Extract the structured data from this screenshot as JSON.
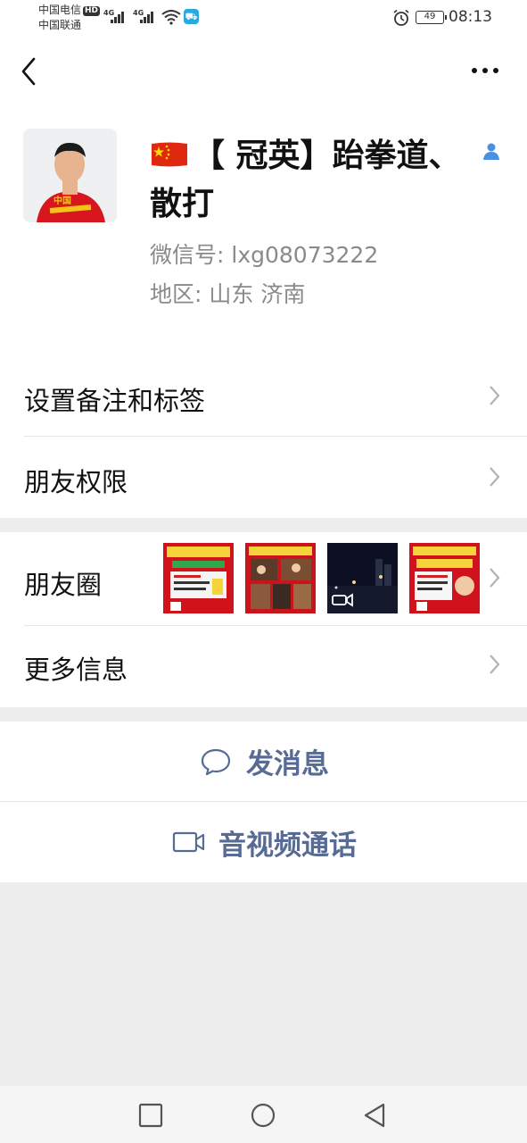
{
  "status": {
    "carrier1": "中国电信",
    "carrier1_badge": "HD",
    "carrier2": "中国联通",
    "net1": "4G",
    "net2": "4G",
    "battery": "49",
    "time": "08:13"
  },
  "header": {
    "back_icon": "chevron-left-icon",
    "more_icon": "more-dots-icon"
  },
  "profile": {
    "nickname": "【 冠英】跆拳道、散打",
    "wechat_id": "微信号: lxg08073222",
    "region": "地区: 山东  济南",
    "verify_icon": "person-badge-icon"
  },
  "menu": {
    "remark_tags": "设置备注和标签",
    "friend_permissions": "朋友权限",
    "moments": "朋友圈",
    "more_info": "更多信息"
  },
  "actions": {
    "send_message": "发消息",
    "av_call": "音视频通话"
  },
  "colors": {
    "link": "#576b95",
    "bg": "#ededed",
    "accent_red": "#d7161e"
  }
}
